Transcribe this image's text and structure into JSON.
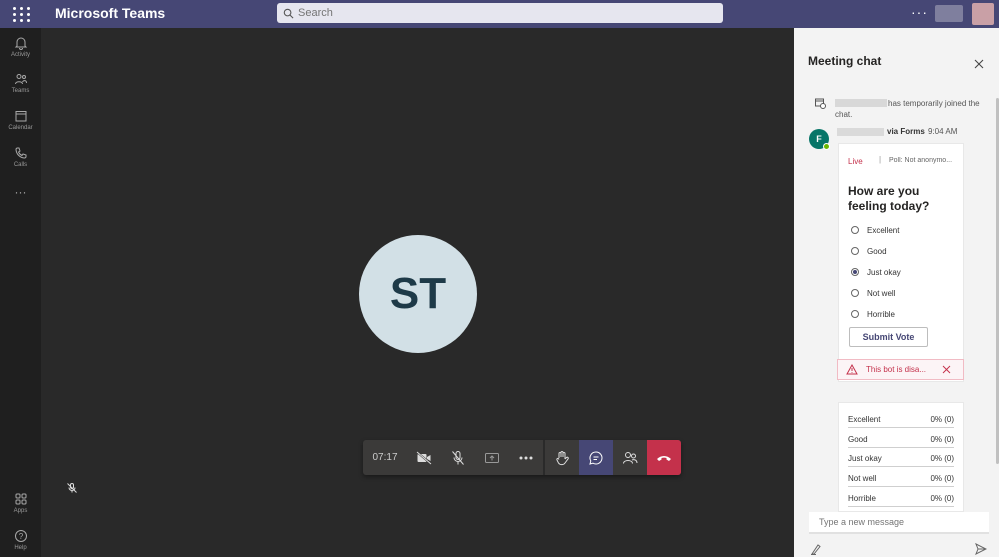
{
  "app": {
    "title": "Microsoft Teams"
  },
  "search": {
    "placeholder": "Search"
  },
  "rail": {
    "items": [
      {
        "label": "Activity",
        "icon": "bell-icon"
      },
      {
        "label": "Teams",
        "icon": "teams-icon"
      },
      {
        "label": "Calendar",
        "icon": "calendar-icon"
      },
      {
        "label": "Calls",
        "icon": "phone-icon"
      },
      {
        "label": "",
        "icon": "more-icon"
      }
    ],
    "bottom": [
      {
        "label": "Apps",
        "icon": "apps-icon"
      },
      {
        "label": "Help",
        "icon": "help-icon"
      }
    ]
  },
  "stage": {
    "avatar_initials": "ST"
  },
  "callbar": {
    "timer": "07:17"
  },
  "chat": {
    "title": "Meeting chat",
    "system_message": "has temporarily joined the chat.",
    "sender_suffix": "via Forms",
    "time": "9:04 AM",
    "poll": {
      "status": "Live",
      "separator": "|",
      "type": "Poll: Not anonymo...",
      "question": "How are you feeling today?",
      "options": [
        "Excellent",
        "Good",
        "Just okay",
        "Not well",
        "Horrible"
      ],
      "selected_index": 2,
      "submit_label": "Submit Vote"
    },
    "alert": "This bot is disa...",
    "results": [
      {
        "label": "Excellent",
        "value": "0% (0)"
      },
      {
        "label": "Good",
        "value": "0% (0)"
      },
      {
        "label": "Just okay",
        "value": "0% (0)"
      },
      {
        "label": "Not well",
        "value": "0% (0)"
      },
      {
        "label": "Horrible",
        "value": "0% (0)"
      }
    ],
    "compose_placeholder": "Type a new message"
  },
  "colors": {
    "brand": "#464775",
    "hangup": "#c4314b",
    "bot": "#077568"
  }
}
